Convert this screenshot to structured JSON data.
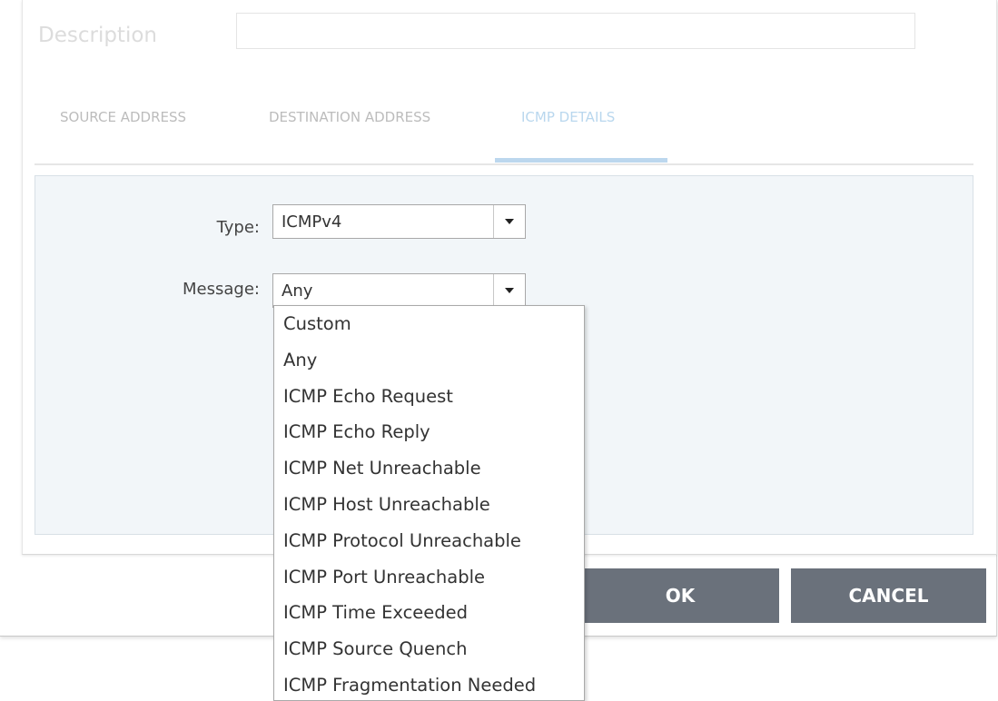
{
  "description": {
    "label": "Description",
    "value": ""
  },
  "tabs": [
    {
      "label": "SOURCE ADDRESS"
    },
    {
      "label": "DESTINATION ADDRESS"
    },
    {
      "label": "ICMP DETAILS",
      "active": true
    }
  ],
  "type_field": {
    "label": "Type:",
    "value": "ICMPv4"
  },
  "message_field": {
    "label": "Message:",
    "value": "Any",
    "options": [
      "Custom",
      "Any",
      "ICMP Echo Request",
      "ICMP Echo Reply",
      "ICMP Net Unreachable",
      "ICMP Host Unreachable",
      "ICMP Protocol Unreachable",
      "ICMP Port Unreachable",
      "ICMP Time Exceeded",
      "ICMP Source Quench",
      "ICMP Fragmentation Needed"
    ]
  },
  "buttons": {
    "ok": "OK",
    "cancel": "CANCEL"
  },
  "colors": {
    "active_tab": "#b9d7ee",
    "button_bg": "#6a717b",
    "content_bg": "#f2f6f9"
  },
  "icons": {
    "dropdown_arrow": "chevron-down-icon"
  }
}
